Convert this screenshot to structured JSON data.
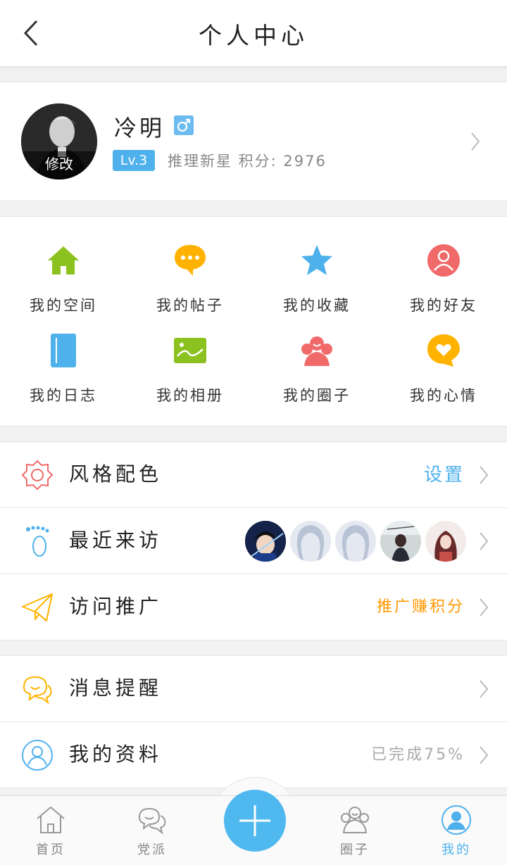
{
  "header": {
    "title": "个人中心"
  },
  "profile": {
    "name": "冷明",
    "avatar_edit_label": "修改",
    "level": "Lv.3",
    "rank_text": "推理新星  积分: 2976"
  },
  "grid": [
    {
      "label": "我的空间",
      "icon": "house-icon",
      "color": "#8cc21f"
    },
    {
      "label": "我的帖子",
      "icon": "chat-bubble-icon",
      "color": "#ffb300"
    },
    {
      "label": "我的收藏",
      "icon": "star-icon",
      "color": "#4fb1ec"
    },
    {
      "label": "我的好友",
      "icon": "friend-icon",
      "color": "#f06a6a"
    },
    {
      "label": "我的日志",
      "icon": "notebook-icon",
      "color": "#4fb1ec"
    },
    {
      "label": "我的相册",
      "icon": "photo-icon",
      "color": "#8cc21f"
    },
    {
      "label": "我的圈子",
      "icon": "group-icon",
      "color": "#f06a6a"
    },
    {
      "label": "我的心情",
      "icon": "heart-bubble-icon",
      "color": "#ffb300"
    }
  ],
  "menu1": [
    {
      "label": "风格配色",
      "value": "设置",
      "value_color": "#4fb1ec"
    },
    {
      "label": "最近来访",
      "value": ""
    },
    {
      "label": "访问推广",
      "value": "推广赚积分",
      "value_color": "#ff9800"
    }
  ],
  "menu2": [
    {
      "label": "消息提醒",
      "value": ""
    },
    {
      "label": "我的资料",
      "value": "已完成75%",
      "value_color": "#aaaaaa"
    }
  ],
  "tabbar": [
    {
      "label": "首页",
      "icon": "home-tab-icon"
    },
    {
      "label": "党派",
      "icon": "party-tab-icon"
    },
    {
      "label": "圈子",
      "icon": "circle-tab-icon"
    },
    {
      "label": "我的",
      "icon": "me-tab-icon",
      "active": true
    }
  ],
  "colors": {
    "accent": "#4fb1ec",
    "orange": "#ff9800"
  }
}
